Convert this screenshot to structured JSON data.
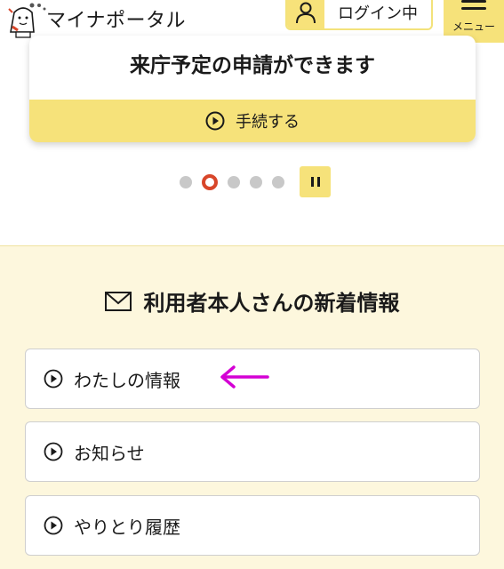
{
  "header": {
    "brand": "マイナポータル",
    "login_label": "ログイン中",
    "menu_label": "メニュー"
  },
  "carousel": {
    "card_title": "来庁予定の申請ができます",
    "action_label": "手続する",
    "slide_count": 5,
    "active_slide": 2
  },
  "news": {
    "title": "利用者本人さんの新着情報",
    "items": [
      {
        "label": "わたしの情報"
      },
      {
        "label": "お知らせ"
      },
      {
        "label": "やりとり履歴"
      }
    ]
  },
  "annotation": {
    "arrow_color": "#d400d4"
  },
  "colors": {
    "accent": "#f6e27a",
    "active_dot": "#d8462a",
    "news_bg": "#fdf7dd"
  }
}
